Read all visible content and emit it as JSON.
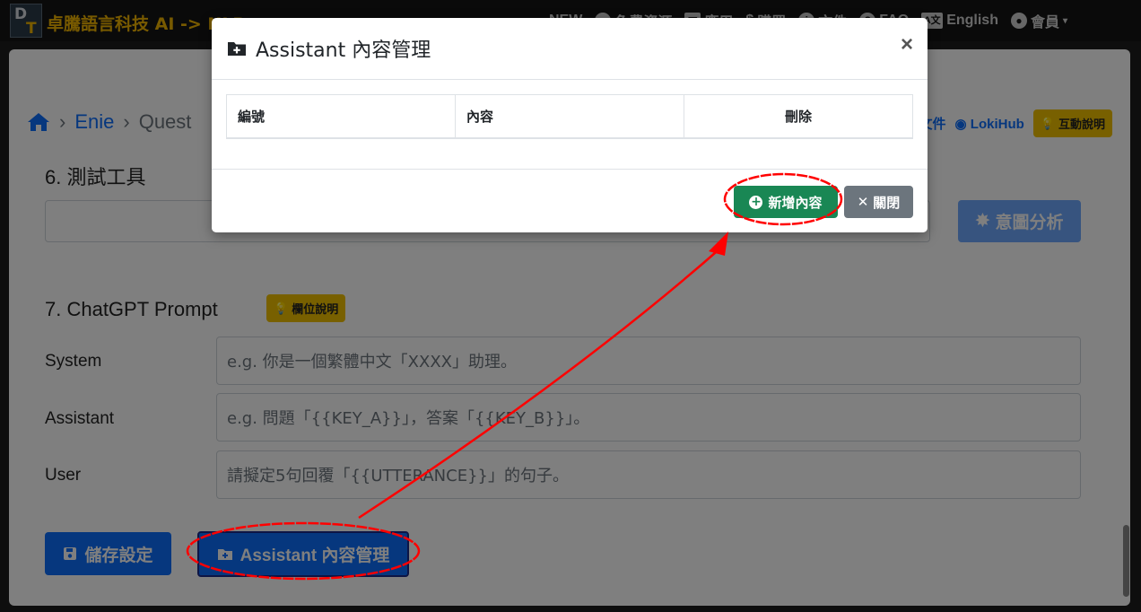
{
  "navbar": {
    "logo_d": "D",
    "logo_t": "T",
    "brand": "卓騰語言科技 AI -> NLP",
    "items": [
      {
        "label": "NEW",
        "icon": "new-icon"
      },
      {
        "label": "免費資源",
        "icon": "database-icon"
      },
      {
        "label": "應用",
        "icon": "apps-icon"
      },
      {
        "label": "購買",
        "icon": "dollar-icon"
      },
      {
        "label": "文件",
        "icon": "info-icon"
      },
      {
        "label": "FAQ",
        "icon": "question-icon"
      },
      {
        "label": "English",
        "icon": "language-icon"
      },
      {
        "label": "會員",
        "icon": "user-icon"
      }
    ]
  },
  "page": {
    "breadcrumb": [
      "Enie",
      "Quest"
    ],
    "top_links": {
      "docs": "文件",
      "lokihub": "LokiHub",
      "help": "互動說明"
    },
    "section6_title": "6. 測試工具",
    "analyze_button": "意圖分析",
    "section7_title": "7. ChatGPT Prompt",
    "field_help": "欄位說明",
    "rows": [
      {
        "label": "System",
        "placeholder": "e.g. 你是一個繁體中文「XXXX」助理。"
      },
      {
        "label": "Assistant",
        "placeholder": "e.g. 問題「{{KEY_A}}」，答案「{{KEY_B}}」。"
      },
      {
        "label": "User",
        "placeholder": "請擬定5句回覆「{{UTTERANCE}}」的句子。"
      }
    ],
    "save_button": "儲存設定",
    "assistant_button": "Assistant 內容管理"
  },
  "modal": {
    "title": "Assistant 內容管理",
    "close_symbol": "×",
    "columns": [
      "編號",
      "內容",
      "刪除"
    ],
    "add_button": "新增內容",
    "close_button": "關閉"
  },
  "colors": {
    "primary": "#0d6efd",
    "success": "#198754",
    "secondary": "#6c757d",
    "brand": "#f0b400",
    "annotation": "#ff0000"
  }
}
